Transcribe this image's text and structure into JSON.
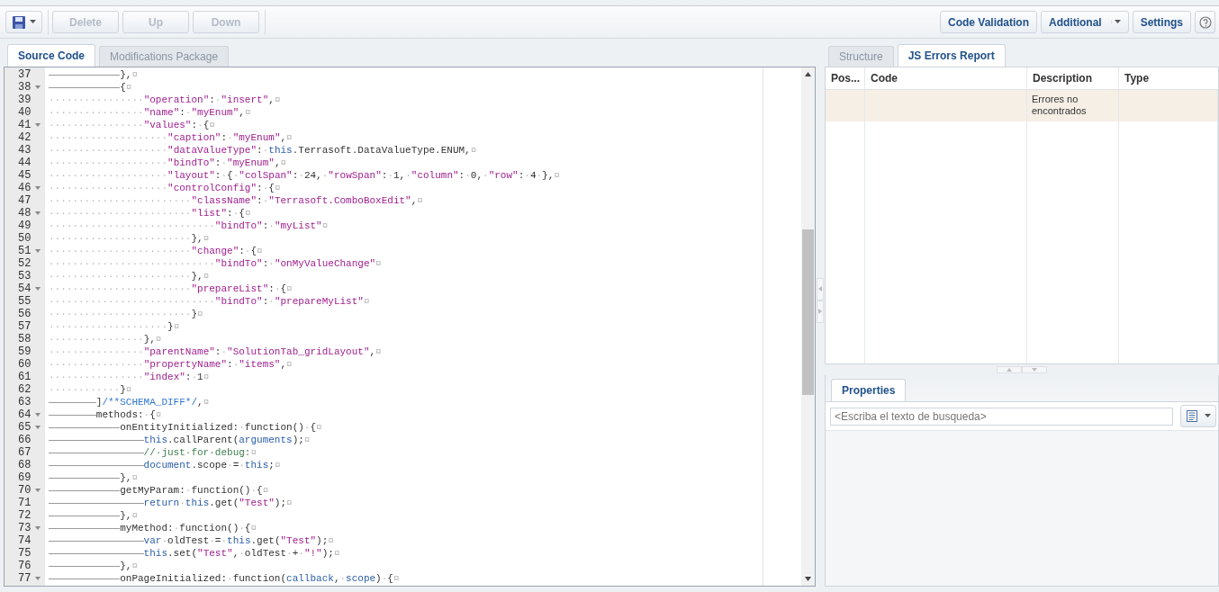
{
  "toolbar": {
    "left_buttons": [
      {
        "label": "Delete",
        "disabled": true
      },
      {
        "label": "Up",
        "disabled": true
      },
      {
        "label": "Down",
        "disabled": true
      }
    ],
    "right_buttons": [
      {
        "label": "Code Validation",
        "kind": "button"
      },
      {
        "label": "Additional",
        "kind": "split"
      },
      {
        "label": "Settings",
        "kind": "button"
      },
      {
        "kind": "help"
      }
    ]
  },
  "editor": {
    "tabs": [
      {
        "label": "Source Code",
        "selected": true
      },
      {
        "label": "Modifications Package",
        "selected": false
      }
    ],
    "lines": [
      {
        "num": "37",
        "fold": false,
        "tokens": [
          {
            "kind": "tab"
          },
          {
            "kind": "tab"
          },
          {
            "kind": "tab"
          },
          {
            "kind": "plain",
            "text": "},"
          },
          {
            "kind": "ws",
            "text": "¤"
          }
        ]
      },
      {
        "num": "38",
        "fold": true,
        "tokens": [
          {
            "kind": "tab"
          },
          {
            "kind": "tab"
          },
          {
            "kind": "tab"
          },
          {
            "kind": "plain",
            "text": "{"
          },
          {
            "kind": "ws",
            "text": "¤"
          }
        ]
      },
      {
        "num": "39",
        "fold": false,
        "tokens": [
          {
            "kind": "ws",
            "text": "················"
          },
          {
            "kind": "str",
            "text": "\"operation\""
          },
          {
            "kind": "plain",
            "text": ":"
          },
          {
            "kind": "ws",
            "text": "·"
          },
          {
            "kind": "str",
            "text": "\"insert\""
          },
          {
            "kind": "plain",
            "text": ","
          },
          {
            "kind": "ws",
            "text": "¤"
          }
        ]
      },
      {
        "num": "40",
        "fold": false,
        "tokens": [
          {
            "kind": "ws",
            "text": "················"
          },
          {
            "kind": "str",
            "text": "\"name\""
          },
          {
            "kind": "plain",
            "text": ":"
          },
          {
            "kind": "ws",
            "text": "·"
          },
          {
            "kind": "str",
            "text": "\"myEnum\""
          },
          {
            "kind": "plain",
            "text": ","
          },
          {
            "kind": "ws",
            "text": "¤"
          }
        ]
      },
      {
        "num": "41",
        "fold": true,
        "tokens": [
          {
            "kind": "ws",
            "text": "················"
          },
          {
            "kind": "str",
            "text": "\"values\""
          },
          {
            "kind": "plain",
            "text": ":"
          },
          {
            "kind": "ws",
            "text": "·"
          },
          {
            "kind": "plain",
            "text": "{"
          },
          {
            "kind": "ws",
            "text": "¤"
          }
        ]
      },
      {
        "num": "42",
        "fold": false,
        "tokens": [
          {
            "kind": "ws",
            "text": "····················"
          },
          {
            "kind": "str",
            "text": "\"caption\""
          },
          {
            "kind": "plain",
            "text": ":"
          },
          {
            "kind": "ws",
            "text": "·"
          },
          {
            "kind": "str",
            "text": "\"myEnum\""
          },
          {
            "kind": "plain",
            "text": ","
          },
          {
            "kind": "ws",
            "text": "¤"
          }
        ]
      },
      {
        "num": "43",
        "fold": false,
        "tokens": [
          {
            "kind": "ws",
            "text": "····················"
          },
          {
            "kind": "str",
            "text": "\"dataValueType\""
          },
          {
            "kind": "plain",
            "text": ":"
          },
          {
            "kind": "ws",
            "text": "·"
          },
          {
            "kind": "kw",
            "text": "this"
          },
          {
            "kind": "plain",
            "text": ".Terrasoft.DataValueType.ENUM,"
          },
          {
            "kind": "ws",
            "text": "¤"
          }
        ]
      },
      {
        "num": "44",
        "fold": false,
        "tokens": [
          {
            "kind": "ws",
            "text": "····················"
          },
          {
            "kind": "str",
            "text": "\"bindTo\""
          },
          {
            "kind": "plain",
            "text": ":"
          },
          {
            "kind": "ws",
            "text": "·"
          },
          {
            "kind": "str",
            "text": "\"myEnum\""
          },
          {
            "kind": "plain",
            "text": ","
          },
          {
            "kind": "ws",
            "text": "¤"
          }
        ]
      },
      {
        "num": "45",
        "fold": false,
        "tokens": [
          {
            "kind": "ws",
            "text": "····················"
          },
          {
            "kind": "str",
            "text": "\"layout\""
          },
          {
            "kind": "plain",
            "text": ":"
          },
          {
            "kind": "ws",
            "text": "·"
          },
          {
            "kind": "plain",
            "text": "{"
          },
          {
            "kind": "ws",
            "text": "·"
          },
          {
            "kind": "str",
            "text": "\"colSpan\""
          },
          {
            "kind": "plain",
            "text": ":"
          },
          {
            "kind": "ws",
            "text": "·"
          },
          {
            "kind": "plain",
            "text": "24,"
          },
          {
            "kind": "ws",
            "text": "·"
          },
          {
            "kind": "str",
            "text": "\"rowSpan\""
          },
          {
            "kind": "plain",
            "text": ":"
          },
          {
            "kind": "ws",
            "text": "·"
          },
          {
            "kind": "plain",
            "text": "1,"
          },
          {
            "kind": "ws",
            "text": "·"
          },
          {
            "kind": "str",
            "text": "\"column\""
          },
          {
            "kind": "plain",
            "text": ":"
          },
          {
            "kind": "ws",
            "text": "·"
          },
          {
            "kind": "plain",
            "text": "0,"
          },
          {
            "kind": "ws",
            "text": "·"
          },
          {
            "kind": "str",
            "text": "\"row\""
          },
          {
            "kind": "plain",
            "text": ":"
          },
          {
            "kind": "ws",
            "text": "·"
          },
          {
            "kind": "plain",
            "text": "4"
          },
          {
            "kind": "ws",
            "text": "·"
          },
          {
            "kind": "plain",
            "text": "},"
          },
          {
            "kind": "ws",
            "text": "¤"
          }
        ]
      },
      {
        "num": "46",
        "fold": true,
        "tokens": [
          {
            "kind": "ws",
            "text": "····················"
          },
          {
            "kind": "str",
            "text": "\"controlConfig\""
          },
          {
            "kind": "plain",
            "text": ":"
          },
          {
            "kind": "ws",
            "text": "·"
          },
          {
            "kind": "plain",
            "text": "{"
          },
          {
            "kind": "ws",
            "text": "¤"
          }
        ]
      },
      {
        "num": "47",
        "fold": false,
        "tokens": [
          {
            "kind": "ws",
            "text": "························"
          },
          {
            "kind": "str",
            "text": "\"className\""
          },
          {
            "kind": "plain",
            "text": ":"
          },
          {
            "kind": "ws",
            "text": "·"
          },
          {
            "kind": "str",
            "text": "\"Terrasoft.ComboBoxEdit\""
          },
          {
            "kind": "plain",
            "text": ","
          },
          {
            "kind": "ws",
            "text": "¤"
          }
        ]
      },
      {
        "num": "48",
        "fold": true,
        "tokens": [
          {
            "kind": "ws",
            "text": "························"
          },
          {
            "kind": "str",
            "text": "\"list\""
          },
          {
            "kind": "plain",
            "text": ":"
          },
          {
            "kind": "ws",
            "text": "·"
          },
          {
            "kind": "plain",
            "text": "{"
          },
          {
            "kind": "ws",
            "text": "¤"
          }
        ]
      },
      {
        "num": "49",
        "fold": false,
        "tokens": [
          {
            "kind": "ws",
            "text": "····························"
          },
          {
            "kind": "str",
            "text": "\"bindTo\""
          },
          {
            "kind": "plain",
            "text": ":"
          },
          {
            "kind": "ws",
            "text": "·"
          },
          {
            "kind": "str",
            "text": "\"myList\""
          },
          {
            "kind": "ws",
            "text": "¤"
          }
        ]
      },
      {
        "num": "50",
        "fold": false,
        "tokens": [
          {
            "kind": "ws",
            "text": "························"
          },
          {
            "kind": "plain",
            "text": "},"
          },
          {
            "kind": "ws",
            "text": "¤"
          }
        ]
      },
      {
        "num": "51",
        "fold": true,
        "tokens": [
          {
            "kind": "ws",
            "text": "························"
          },
          {
            "kind": "str",
            "text": "\"change\""
          },
          {
            "kind": "plain",
            "text": ":"
          },
          {
            "kind": "ws",
            "text": "·"
          },
          {
            "kind": "plain",
            "text": "{"
          },
          {
            "kind": "ws",
            "text": "¤"
          }
        ]
      },
      {
        "num": "52",
        "fold": false,
        "tokens": [
          {
            "kind": "ws",
            "text": "····························"
          },
          {
            "kind": "str",
            "text": "\"bindTo\""
          },
          {
            "kind": "plain",
            "text": ":"
          },
          {
            "kind": "ws",
            "text": "·"
          },
          {
            "kind": "str",
            "text": "\"onMyValueChange\""
          },
          {
            "kind": "ws",
            "text": "¤"
          }
        ]
      },
      {
        "num": "53",
        "fold": false,
        "tokens": [
          {
            "kind": "ws",
            "text": "························"
          },
          {
            "kind": "plain",
            "text": "},"
          },
          {
            "kind": "ws",
            "text": "¤"
          }
        ]
      },
      {
        "num": "54",
        "fold": true,
        "tokens": [
          {
            "kind": "ws",
            "text": "························"
          },
          {
            "kind": "str",
            "text": "\"prepareList\""
          },
          {
            "kind": "plain",
            "text": ":"
          },
          {
            "kind": "ws",
            "text": "·"
          },
          {
            "kind": "plain",
            "text": "{"
          },
          {
            "kind": "ws",
            "text": "¤"
          }
        ]
      },
      {
        "num": "55",
        "fold": false,
        "tokens": [
          {
            "kind": "ws",
            "text": "····························"
          },
          {
            "kind": "str",
            "text": "\"bindTo\""
          },
          {
            "kind": "plain",
            "text": ":"
          },
          {
            "kind": "ws",
            "text": "·"
          },
          {
            "kind": "str",
            "text": "\"prepareMyList\""
          },
          {
            "kind": "ws",
            "text": "¤"
          }
        ]
      },
      {
        "num": "56",
        "fold": false,
        "tokens": [
          {
            "kind": "ws",
            "text": "························"
          },
          {
            "kind": "plain",
            "text": "}"
          },
          {
            "kind": "ws",
            "text": "¤"
          }
        ]
      },
      {
        "num": "57",
        "fold": false,
        "tokens": [
          {
            "kind": "ws",
            "text": "····················"
          },
          {
            "kind": "plain",
            "text": "}"
          },
          {
            "kind": "ws",
            "text": "¤"
          }
        ]
      },
      {
        "num": "58",
        "fold": false,
        "tokens": [
          {
            "kind": "ws",
            "text": "················"
          },
          {
            "kind": "plain",
            "text": "},"
          },
          {
            "kind": "ws",
            "text": "¤"
          }
        ]
      },
      {
        "num": "59",
        "fold": false,
        "tokens": [
          {
            "kind": "ws",
            "text": "················"
          },
          {
            "kind": "str",
            "text": "\"parentName\""
          },
          {
            "kind": "plain",
            "text": ":"
          },
          {
            "kind": "ws",
            "text": "·"
          },
          {
            "kind": "str",
            "text": "\"SolutionTab_gridLayout\""
          },
          {
            "kind": "plain",
            "text": ","
          },
          {
            "kind": "ws",
            "text": "¤"
          }
        ]
      },
      {
        "num": "60",
        "fold": false,
        "tokens": [
          {
            "kind": "ws",
            "text": "················"
          },
          {
            "kind": "str",
            "text": "\"propertyName\""
          },
          {
            "kind": "plain",
            "text": ":"
          },
          {
            "kind": "ws",
            "text": "·"
          },
          {
            "kind": "str",
            "text": "\"items\""
          },
          {
            "kind": "plain",
            "text": ","
          },
          {
            "kind": "ws",
            "text": "¤"
          }
        ]
      },
      {
        "num": "61",
        "fold": false,
        "tokens": [
          {
            "kind": "ws",
            "text": "················"
          },
          {
            "kind": "str",
            "text": "\"index\""
          },
          {
            "kind": "plain",
            "text": ":"
          },
          {
            "kind": "ws",
            "text": "·"
          },
          {
            "kind": "plain",
            "text": "1"
          },
          {
            "kind": "ws",
            "text": "¤"
          }
        ]
      },
      {
        "num": "62",
        "fold": false,
        "tokens": [
          {
            "kind": "ws",
            "text": "············"
          },
          {
            "kind": "plain",
            "text": "}"
          },
          {
            "kind": "ws",
            "text": "¤"
          }
        ]
      },
      {
        "num": "63",
        "fold": false,
        "tokens": [
          {
            "kind": "tab"
          },
          {
            "kind": "tab"
          },
          {
            "kind": "plain",
            "text": "]"
          },
          {
            "kind": "doc",
            "text": "/**SCHEMA_DIFF*/"
          },
          {
            "kind": "plain",
            "text": ","
          },
          {
            "kind": "ws",
            "text": "¤"
          }
        ]
      },
      {
        "num": "64",
        "fold": true,
        "tokens": [
          {
            "kind": "tab"
          },
          {
            "kind": "tab"
          },
          {
            "kind": "plain",
            "text": "methods:"
          },
          {
            "kind": "ws",
            "text": "·"
          },
          {
            "kind": "plain",
            "text": "{"
          },
          {
            "kind": "ws",
            "text": "¤"
          }
        ]
      },
      {
        "num": "65",
        "fold": true,
        "tokens": [
          {
            "kind": "tab"
          },
          {
            "kind": "tab"
          },
          {
            "kind": "tab"
          },
          {
            "kind": "plain",
            "text": "onEntityInitialized:"
          },
          {
            "kind": "ws",
            "text": "·"
          },
          {
            "kind": "plain",
            "text": "function()"
          },
          {
            "kind": "ws",
            "text": "·"
          },
          {
            "kind": "plain",
            "text": "{"
          },
          {
            "kind": "ws",
            "text": "¤"
          }
        ]
      },
      {
        "num": "66",
        "fold": false,
        "tokens": [
          {
            "kind": "tab"
          },
          {
            "kind": "tab"
          },
          {
            "kind": "tab"
          },
          {
            "kind": "tab"
          },
          {
            "kind": "kw",
            "text": "this"
          },
          {
            "kind": "plain",
            "text": ".callParent("
          },
          {
            "kind": "kw",
            "text": "arguments"
          },
          {
            "kind": "plain",
            "text": ");"
          },
          {
            "kind": "ws",
            "text": "¤"
          }
        ]
      },
      {
        "num": "67",
        "fold": false,
        "tokens": [
          {
            "kind": "tab"
          },
          {
            "kind": "tab"
          },
          {
            "kind": "tab"
          },
          {
            "kind": "tab"
          },
          {
            "kind": "comment",
            "text": "//·just·for·debug:"
          },
          {
            "kind": "ws",
            "text": "¤"
          }
        ]
      },
      {
        "num": "68",
        "fold": false,
        "tokens": [
          {
            "kind": "tab"
          },
          {
            "kind": "tab"
          },
          {
            "kind": "tab"
          },
          {
            "kind": "tab"
          },
          {
            "kind": "kw",
            "text": "document"
          },
          {
            "kind": "plain",
            "text": ".scope"
          },
          {
            "kind": "ws",
            "text": "·"
          },
          {
            "kind": "plain",
            "text": "="
          },
          {
            "kind": "ws",
            "text": "·"
          },
          {
            "kind": "kw",
            "text": "this"
          },
          {
            "kind": "plain",
            "text": ";"
          },
          {
            "kind": "ws",
            "text": "¤"
          }
        ]
      },
      {
        "num": "69",
        "fold": false,
        "tokens": [
          {
            "kind": "tab"
          },
          {
            "kind": "tab"
          },
          {
            "kind": "tab"
          },
          {
            "kind": "plain",
            "text": "},"
          },
          {
            "kind": "ws",
            "text": "¤"
          }
        ]
      },
      {
        "num": "70",
        "fold": true,
        "tokens": [
          {
            "kind": "tab"
          },
          {
            "kind": "tab"
          },
          {
            "kind": "tab"
          },
          {
            "kind": "plain",
            "text": "getMyParam:"
          },
          {
            "kind": "ws",
            "text": "·"
          },
          {
            "kind": "plain",
            "text": "function()"
          },
          {
            "kind": "ws",
            "text": "·"
          },
          {
            "kind": "plain",
            "text": "{"
          },
          {
            "kind": "ws",
            "text": "¤"
          }
        ]
      },
      {
        "num": "71",
        "fold": false,
        "tokens": [
          {
            "kind": "tab"
          },
          {
            "kind": "tab"
          },
          {
            "kind": "tab"
          },
          {
            "kind": "tab"
          },
          {
            "kind": "kw",
            "text": "return"
          },
          {
            "kind": "ws",
            "text": "·"
          },
          {
            "kind": "kw",
            "text": "this"
          },
          {
            "kind": "plain",
            "text": ".get("
          },
          {
            "kind": "str",
            "text": "\"Test\""
          },
          {
            "kind": "plain",
            "text": ");"
          },
          {
            "kind": "ws",
            "text": "¤"
          }
        ]
      },
      {
        "num": "72",
        "fold": false,
        "tokens": [
          {
            "kind": "tab"
          },
          {
            "kind": "tab"
          },
          {
            "kind": "tab"
          },
          {
            "kind": "plain",
            "text": "},"
          },
          {
            "kind": "ws",
            "text": "¤"
          }
        ]
      },
      {
        "num": "73",
        "fold": true,
        "tokens": [
          {
            "kind": "tab"
          },
          {
            "kind": "tab"
          },
          {
            "kind": "tab"
          },
          {
            "kind": "plain",
            "text": "myMethod:"
          },
          {
            "kind": "ws",
            "text": "·"
          },
          {
            "kind": "plain",
            "text": "function()"
          },
          {
            "kind": "ws",
            "text": "·"
          },
          {
            "kind": "plain",
            "text": "{"
          },
          {
            "kind": "ws",
            "text": "¤"
          }
        ]
      },
      {
        "num": "74",
        "fold": false,
        "tokens": [
          {
            "kind": "tab"
          },
          {
            "kind": "tab"
          },
          {
            "kind": "tab"
          },
          {
            "kind": "tab"
          },
          {
            "kind": "kw",
            "text": "var"
          },
          {
            "kind": "ws",
            "text": "·"
          },
          {
            "kind": "plain",
            "text": "oldTest"
          },
          {
            "kind": "ws",
            "text": "·"
          },
          {
            "kind": "plain",
            "text": "="
          },
          {
            "kind": "ws",
            "text": "·"
          },
          {
            "kind": "kw",
            "text": "this"
          },
          {
            "kind": "plain",
            "text": ".get("
          },
          {
            "kind": "str",
            "text": "\"Test\""
          },
          {
            "kind": "plain",
            "text": ");"
          },
          {
            "kind": "ws",
            "text": "¤"
          }
        ]
      },
      {
        "num": "75",
        "fold": false,
        "tokens": [
          {
            "kind": "tab"
          },
          {
            "kind": "tab"
          },
          {
            "kind": "tab"
          },
          {
            "kind": "tab"
          },
          {
            "kind": "kw",
            "text": "this"
          },
          {
            "kind": "plain",
            "text": ".set("
          },
          {
            "kind": "str",
            "text": "\"Test\""
          },
          {
            "kind": "plain",
            "text": ","
          },
          {
            "kind": "ws",
            "text": "·"
          },
          {
            "kind": "plain",
            "text": "oldTest"
          },
          {
            "kind": "ws",
            "text": "·"
          },
          {
            "kind": "plain",
            "text": "+"
          },
          {
            "kind": "ws",
            "text": "·"
          },
          {
            "kind": "str",
            "text": "\"!\""
          },
          {
            "kind": "plain",
            "text": ");"
          },
          {
            "kind": "ws",
            "text": "¤"
          }
        ]
      },
      {
        "num": "76",
        "fold": false,
        "tokens": [
          {
            "kind": "tab"
          },
          {
            "kind": "tab"
          },
          {
            "kind": "tab"
          },
          {
            "kind": "plain",
            "text": "},"
          },
          {
            "kind": "ws",
            "text": "¤"
          }
        ]
      },
      {
        "num": "77",
        "fold": true,
        "tokens": [
          {
            "kind": "tab"
          },
          {
            "kind": "tab"
          },
          {
            "kind": "tab"
          },
          {
            "kind": "plain",
            "text": "onPageInitialized:"
          },
          {
            "kind": "ws",
            "text": "·"
          },
          {
            "kind": "plain",
            "text": "function("
          },
          {
            "kind": "kw",
            "text": "callback"
          },
          {
            "kind": "plain",
            "text": ","
          },
          {
            "kind": "ws",
            "text": "·"
          },
          {
            "kind": "kw",
            "text": "scope"
          },
          {
            "kind": "plain",
            "text": ")"
          },
          {
            "kind": "ws",
            "text": "·"
          },
          {
            "kind": "plain",
            "text": "{"
          },
          {
            "kind": "ws",
            "text": "¤"
          }
        ]
      }
    ]
  },
  "errors": {
    "tabs": [
      {
        "label": "Structure",
        "selected": false
      },
      {
        "label": "JS Errors Report",
        "selected": true
      }
    ],
    "columns": [
      "Pos...",
      "Code",
      "Description",
      "Type"
    ],
    "rows": [
      {
        "description": "Errores no encontrados",
        "selected": true
      }
    ]
  },
  "properties": {
    "tabs": [
      {
        "label": "Properties",
        "selected": true
      }
    ],
    "search": {
      "placeholder": "<Escriba el texto de busqueda>"
    }
  }
}
